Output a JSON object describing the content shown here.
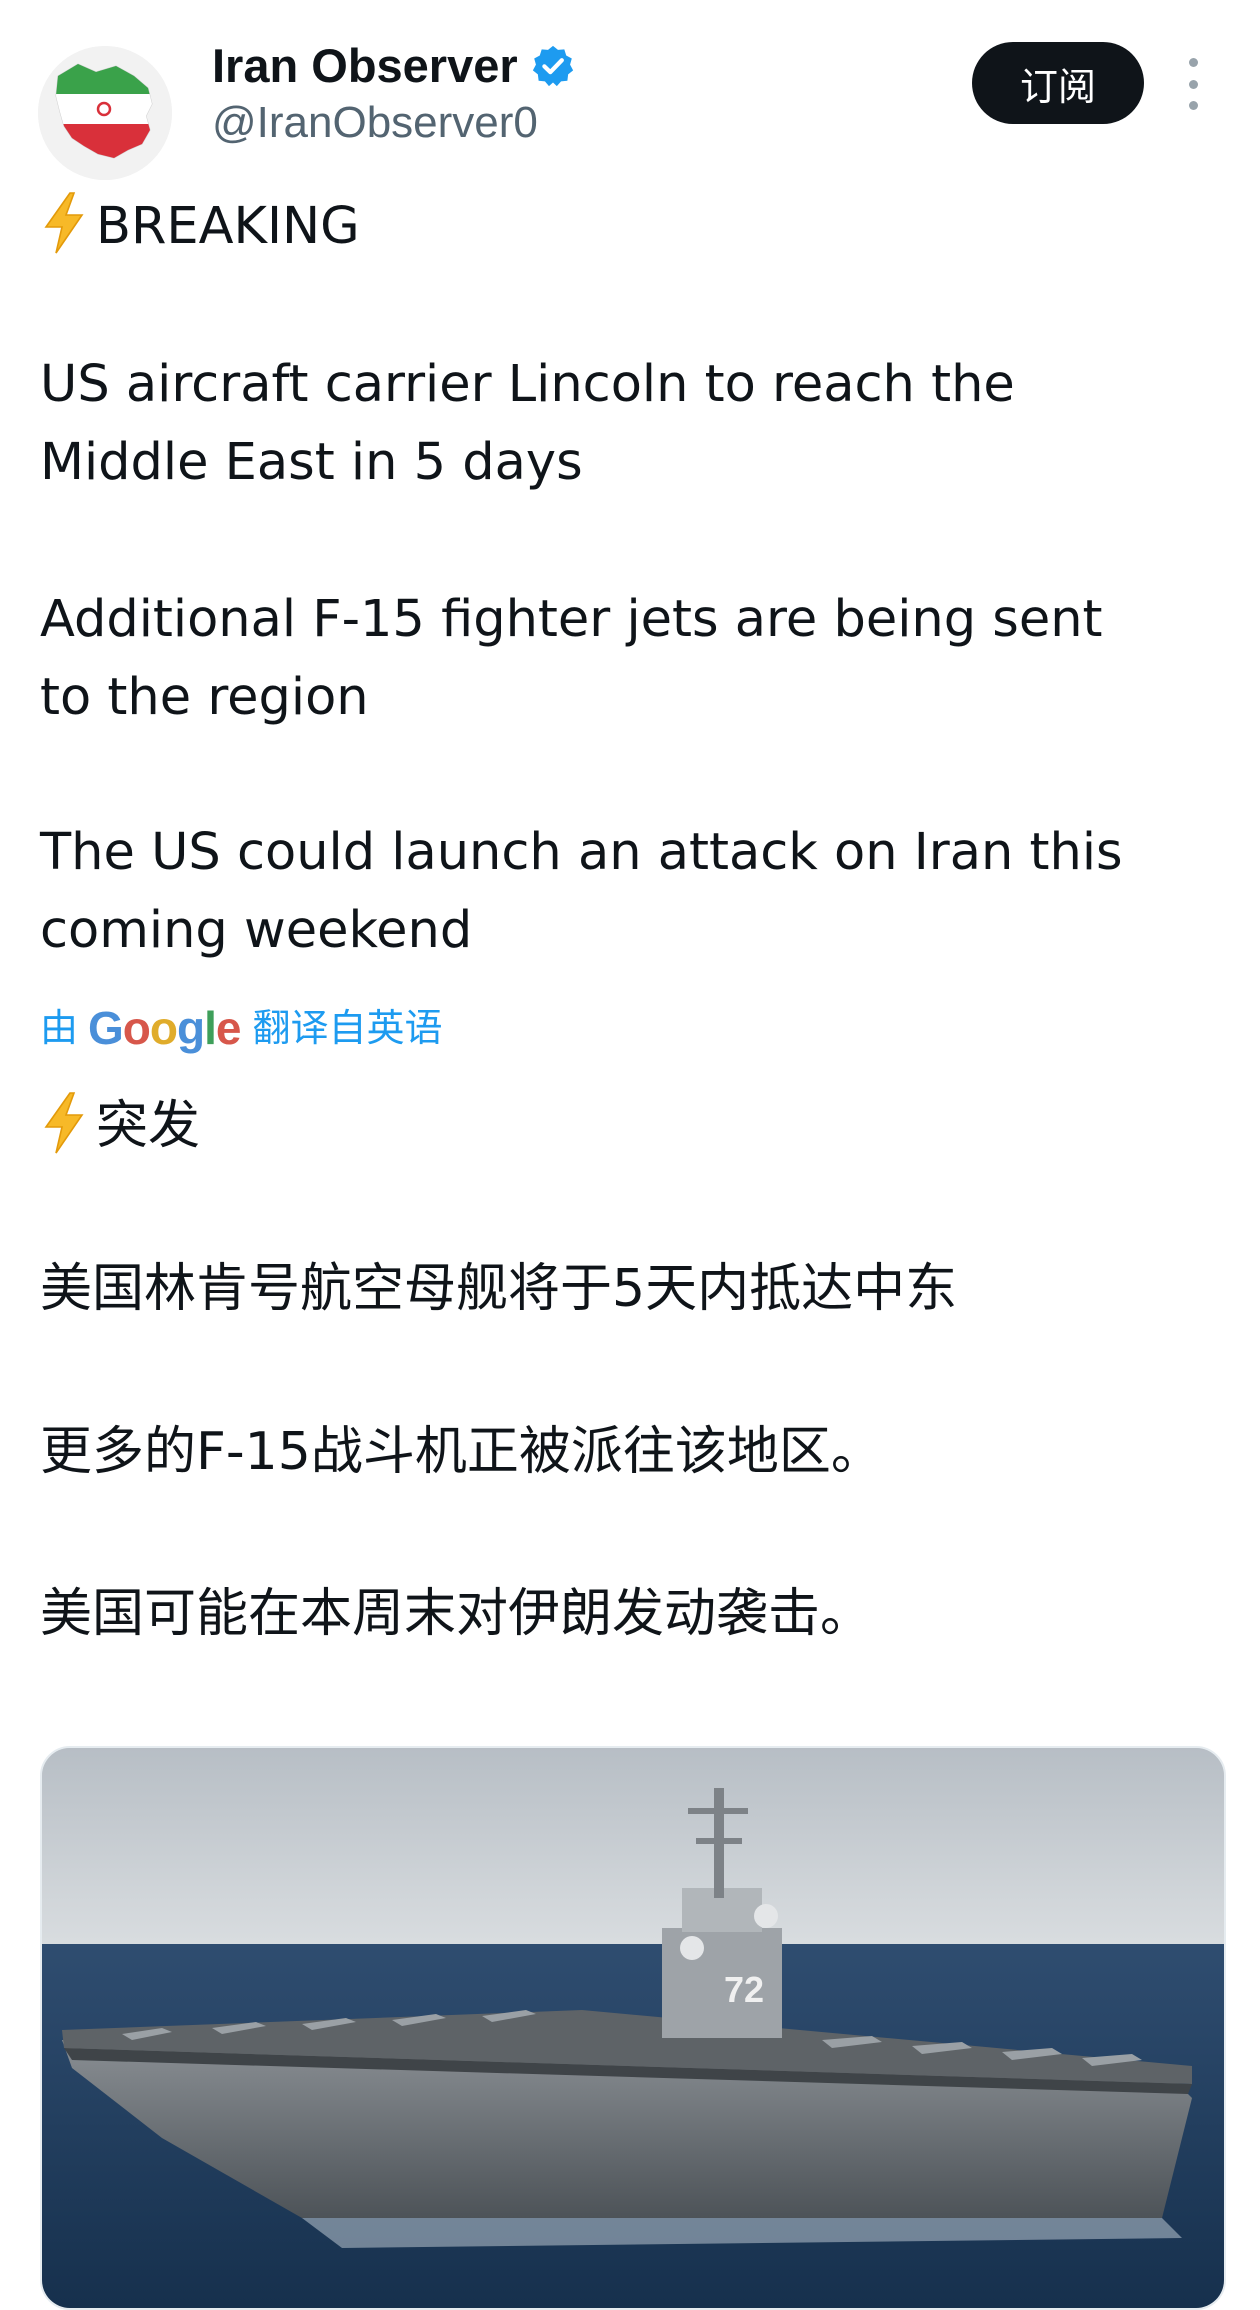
{
  "account": {
    "display_name": "Iran Observer",
    "handle": "@IranObserver0",
    "verified": true,
    "avatar": "iran-map-flag-avatar"
  },
  "header": {
    "subscribe_label": "订阅",
    "more_icon": "more-vertical-icon"
  },
  "tweet": {
    "emoji": "⚡",
    "headline": "BREAKING",
    "lines_en": [
      "US aircraft carrier Lincoln to reach the",
      "Middle East in 5 days",
      "Additional F-15 fighter jets are being sent",
      "to the region",
      "The US could launch an attack on Iran this",
      "coming weekend"
    ]
  },
  "translation": {
    "prefix": "由",
    "brand": "Google",
    "suffix": "翻译自英语",
    "headline": "突发",
    "lines_zh": [
      "美国林肯号航空母舰将于5天内抵达中东",
      "更多的F-15战斗机正被派往该地区。",
      "美国可能在本周末对伊朗发动袭击。"
    ]
  },
  "media": {
    "image": "aircraft-carrier-photo",
    "hull_number": "72"
  },
  "colors": {
    "text": "#0f1419",
    "secondary": "#536471",
    "link": "#1d9bf0",
    "button_bg": "#0f1419",
    "verified": "#1d9bf0"
  }
}
